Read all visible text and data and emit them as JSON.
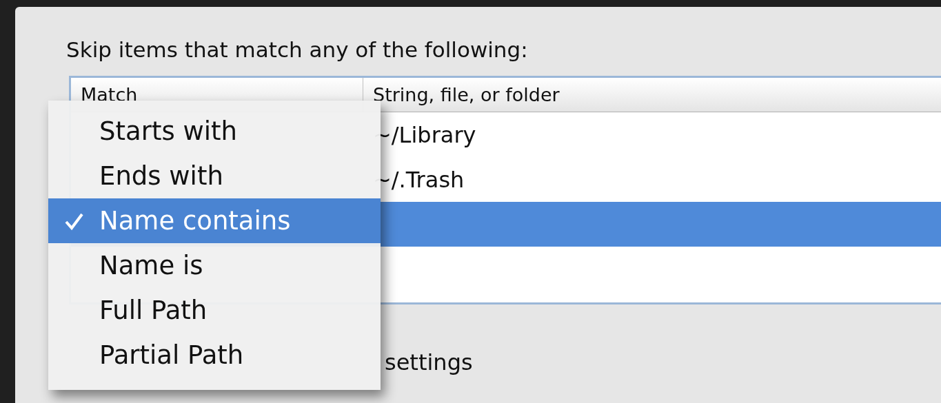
{
  "heading": "Skip items that match any of the following:",
  "table": {
    "columns": [
      "Match",
      "String, file, or folder"
    ],
    "rows": [
      {
        "string": "~/Library",
        "selected": false
      },
      {
        "string": "~/.Trash",
        "selected": false
      },
      {
        "selected": true
      }
    ]
  },
  "option_label": "settings",
  "menu": {
    "items": [
      {
        "label": "Starts with",
        "selected": false
      },
      {
        "label": "Ends with",
        "selected": false
      },
      {
        "label": "Name contains",
        "selected": true
      },
      {
        "label": "Name is",
        "selected": false
      },
      {
        "label": "Full Path",
        "selected": false
      },
      {
        "label": "Partial Path",
        "selected": false
      }
    ]
  }
}
